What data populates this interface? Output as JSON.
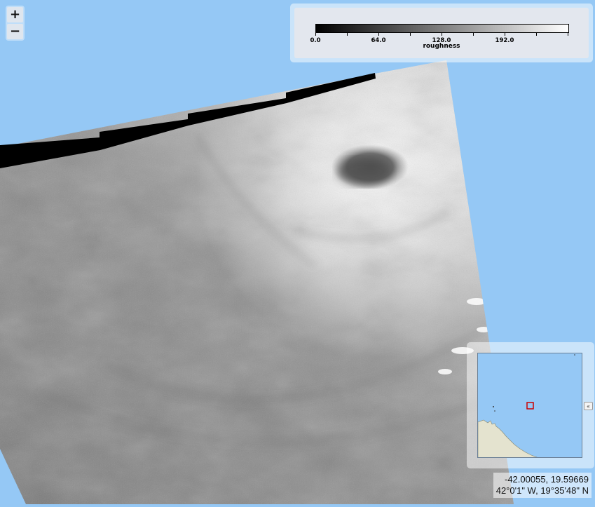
{
  "map": {
    "background_color": "#95c8f5",
    "layer": "SAR roughness imagery (grayscale)",
    "feature": "cyclone eye"
  },
  "zoom": {
    "zoom_in_label": "+",
    "zoom_out_label": "−"
  },
  "legend": {
    "title": "roughness",
    "colormap": "grayscale (black to white)",
    "tick_labels": [
      "0.0",
      "64.0",
      "128.0",
      "192.0"
    ],
    "min": 0,
    "max": 256
  },
  "overview": {
    "toggle_label": "«",
    "colors": {
      "ocean": "#95c8f5",
      "land": "#e4e3cf",
      "extent": "#cc0000"
    }
  },
  "mouse_position": {
    "decimal": "-42.00055, 19.59669",
    "dms": "42°0'1\" W, 19°35'48\" N"
  }
}
